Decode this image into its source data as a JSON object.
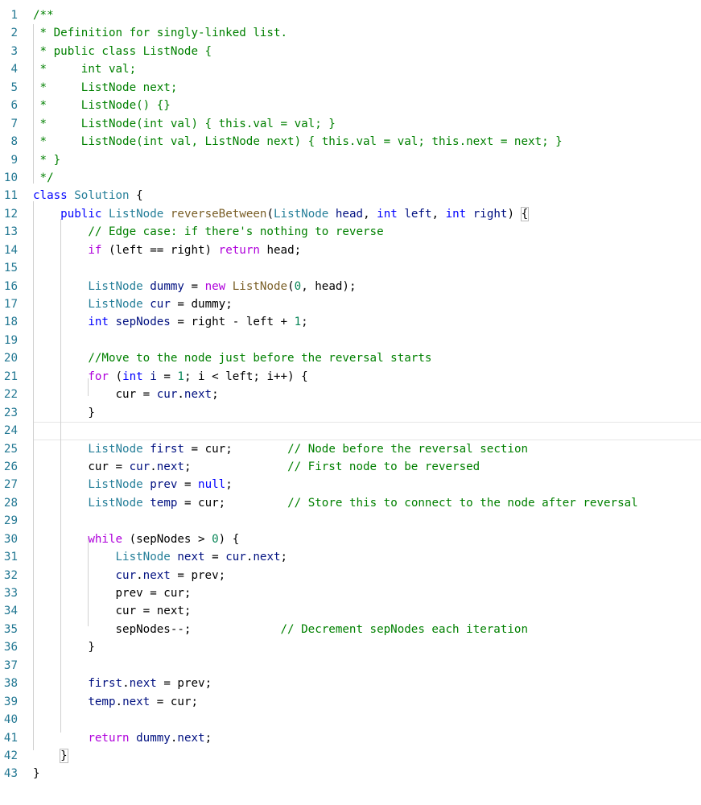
{
  "editor": {
    "language": "java",
    "colors": {
      "background": "#ffffff",
      "line_number": "#237893",
      "keyword": "#0000ff",
      "control": "#af00db",
      "type": "#267f99",
      "function": "#795e26",
      "variable": "#001080",
      "number": "#098658",
      "comment": "#008000",
      "plain": "#000000"
    },
    "current_line": 24,
    "lines": [
      {
        "number": "1",
        "tokens": [
          {
            "text": "/**",
            "type": "comment"
          }
        ]
      },
      {
        "number": "2",
        "tokens": [
          {
            "text": " * Definition for singly-linked list.",
            "type": "comment"
          }
        ]
      },
      {
        "number": "3",
        "tokens": [
          {
            "text": " * public class ListNode {",
            "type": "comment"
          }
        ]
      },
      {
        "number": "4",
        "tokens": [
          {
            "text": " *     int val;",
            "type": "comment"
          }
        ]
      },
      {
        "number": "5",
        "tokens": [
          {
            "text": " *     ListNode next;",
            "type": "comment"
          }
        ]
      },
      {
        "number": "6",
        "tokens": [
          {
            "text": " *     ListNode() {}",
            "type": "comment"
          }
        ]
      },
      {
        "number": "7",
        "tokens": [
          {
            "text": " *     ListNode(int val) { this.val = val; }",
            "type": "comment"
          }
        ]
      },
      {
        "number": "8",
        "tokens": [
          {
            "text": " *     ListNode(int val, ListNode next) { this.val = val; this.next = next; }",
            "type": "comment"
          }
        ]
      },
      {
        "number": "9",
        "tokens": [
          {
            "text": " * }",
            "type": "comment"
          }
        ]
      },
      {
        "number": "10",
        "tokens": [
          {
            "text": " */",
            "type": "comment"
          }
        ]
      },
      {
        "number": "11",
        "tokens": [
          {
            "text": "class",
            "type": "keyword"
          },
          {
            "text": " ",
            "type": "plain"
          },
          {
            "text": "Solution",
            "type": "type"
          },
          {
            "text": " {",
            "type": "plain"
          }
        ]
      },
      {
        "number": "12",
        "tokens": [
          {
            "text": "    ",
            "type": "plain"
          },
          {
            "text": "public",
            "type": "keyword"
          },
          {
            "text": " ",
            "type": "plain"
          },
          {
            "text": "ListNode",
            "type": "type"
          },
          {
            "text": " ",
            "type": "plain"
          },
          {
            "text": "reverseBetween",
            "type": "function"
          },
          {
            "text": "(",
            "type": "plain"
          },
          {
            "text": "ListNode",
            "type": "type"
          },
          {
            "text": " ",
            "type": "plain"
          },
          {
            "text": "head",
            "type": "param"
          },
          {
            "text": ", ",
            "type": "plain"
          },
          {
            "text": "int",
            "type": "keyword"
          },
          {
            "text": " ",
            "type": "plain"
          },
          {
            "text": "left",
            "type": "param"
          },
          {
            "text": ", ",
            "type": "plain"
          },
          {
            "text": "int",
            "type": "keyword"
          },
          {
            "text": " ",
            "type": "plain"
          },
          {
            "text": "right",
            "type": "param"
          },
          {
            "text": ") ",
            "type": "plain"
          },
          {
            "text": "{",
            "type": "plain",
            "box": true
          }
        ]
      },
      {
        "number": "13",
        "tokens": [
          {
            "text": "        ",
            "type": "plain"
          },
          {
            "text": "// Edge case: if there's nothing to reverse",
            "type": "comment"
          }
        ]
      },
      {
        "number": "14",
        "tokens": [
          {
            "text": "        ",
            "type": "plain"
          },
          {
            "text": "if",
            "type": "control"
          },
          {
            "text": " (left == right) ",
            "type": "plain"
          },
          {
            "text": "return",
            "type": "control"
          },
          {
            "text": " head;",
            "type": "plain"
          }
        ]
      },
      {
        "number": "15",
        "tokens": []
      },
      {
        "number": "16",
        "tokens": [
          {
            "text": "        ",
            "type": "plain"
          },
          {
            "text": "ListNode",
            "type": "type"
          },
          {
            "text": " ",
            "type": "plain"
          },
          {
            "text": "dummy",
            "type": "variable"
          },
          {
            "text": " = ",
            "type": "plain"
          },
          {
            "text": "new",
            "type": "control"
          },
          {
            "text": " ",
            "type": "plain"
          },
          {
            "text": "ListNode",
            "type": "function"
          },
          {
            "text": "(",
            "type": "plain"
          },
          {
            "text": "0",
            "type": "number"
          },
          {
            "text": ", head);",
            "type": "plain"
          }
        ]
      },
      {
        "number": "17",
        "tokens": [
          {
            "text": "        ",
            "type": "plain"
          },
          {
            "text": "ListNode",
            "type": "type"
          },
          {
            "text": " ",
            "type": "plain"
          },
          {
            "text": "cur",
            "type": "variable"
          },
          {
            "text": " = dummy;",
            "type": "plain"
          }
        ]
      },
      {
        "number": "18",
        "tokens": [
          {
            "text": "        ",
            "type": "plain"
          },
          {
            "text": "int",
            "type": "keyword"
          },
          {
            "text": " ",
            "type": "plain"
          },
          {
            "text": "sepNodes",
            "type": "variable"
          },
          {
            "text": " = right - left + ",
            "type": "plain"
          },
          {
            "text": "1",
            "type": "number"
          },
          {
            "text": ";",
            "type": "plain"
          }
        ]
      },
      {
        "number": "19",
        "tokens": []
      },
      {
        "number": "20",
        "tokens": [
          {
            "text": "        ",
            "type": "plain"
          },
          {
            "text": "//Move to the node just before the reversal starts",
            "type": "comment"
          }
        ]
      },
      {
        "number": "21",
        "tokens": [
          {
            "text": "        ",
            "type": "plain"
          },
          {
            "text": "for",
            "type": "control"
          },
          {
            "text": " (",
            "type": "plain"
          },
          {
            "text": "int",
            "type": "keyword"
          },
          {
            "text": " ",
            "type": "plain"
          },
          {
            "text": "i",
            "type": "variable"
          },
          {
            "text": " = ",
            "type": "plain"
          },
          {
            "text": "1",
            "type": "number"
          },
          {
            "text": "; i < left; i++) {",
            "type": "plain"
          }
        ]
      },
      {
        "number": "22",
        "tokens": [
          {
            "text": "            ",
            "type": "plain"
          },
          {
            "text": "cur = ",
            "type": "plain"
          },
          {
            "text": "cur",
            "type": "variable"
          },
          {
            "text": ".",
            "type": "plain"
          },
          {
            "text": "next",
            "type": "member"
          },
          {
            "text": ";",
            "type": "plain"
          }
        ]
      },
      {
        "number": "23",
        "tokens": [
          {
            "text": "        ",
            "type": "plain"
          },
          {
            "text": "}",
            "type": "plain"
          }
        ]
      },
      {
        "number": "24",
        "tokens": []
      },
      {
        "number": "25",
        "tokens": [
          {
            "text": "        ",
            "type": "plain"
          },
          {
            "text": "ListNode",
            "type": "type"
          },
          {
            "text": " ",
            "type": "plain"
          },
          {
            "text": "first",
            "type": "variable"
          },
          {
            "text": " = cur;        ",
            "type": "plain"
          },
          {
            "text": "// Node before the reversal section",
            "type": "comment"
          }
        ]
      },
      {
        "number": "26",
        "tokens": [
          {
            "text": "        ",
            "type": "plain"
          },
          {
            "text": "cur = ",
            "type": "plain"
          },
          {
            "text": "cur",
            "type": "variable"
          },
          {
            "text": ".",
            "type": "plain"
          },
          {
            "text": "next",
            "type": "member"
          },
          {
            "text": ";              ",
            "type": "plain"
          },
          {
            "text": "// First node to be reversed",
            "type": "comment"
          }
        ]
      },
      {
        "number": "27",
        "tokens": [
          {
            "text": "        ",
            "type": "plain"
          },
          {
            "text": "ListNode",
            "type": "type"
          },
          {
            "text": " ",
            "type": "plain"
          },
          {
            "text": "prev",
            "type": "variable"
          },
          {
            "text": " = ",
            "type": "plain"
          },
          {
            "text": "null",
            "type": "keyword"
          },
          {
            "text": ";",
            "type": "plain"
          }
        ]
      },
      {
        "number": "28",
        "tokens": [
          {
            "text": "        ",
            "type": "plain"
          },
          {
            "text": "ListNode",
            "type": "type"
          },
          {
            "text": " ",
            "type": "plain"
          },
          {
            "text": "temp",
            "type": "variable"
          },
          {
            "text": " = cur;         ",
            "type": "plain"
          },
          {
            "text": "// Store this to connect to the node after reversal",
            "type": "comment"
          }
        ]
      },
      {
        "number": "29",
        "tokens": []
      },
      {
        "number": "30",
        "tokens": [
          {
            "text": "        ",
            "type": "plain"
          },
          {
            "text": "while",
            "type": "control"
          },
          {
            "text": " (sepNodes > ",
            "type": "plain"
          },
          {
            "text": "0",
            "type": "number"
          },
          {
            "text": ") {",
            "type": "plain"
          }
        ]
      },
      {
        "number": "31",
        "tokens": [
          {
            "text": "            ",
            "type": "plain"
          },
          {
            "text": "ListNode",
            "type": "type"
          },
          {
            "text": " ",
            "type": "plain"
          },
          {
            "text": "next",
            "type": "variable"
          },
          {
            "text": " = ",
            "type": "plain"
          },
          {
            "text": "cur",
            "type": "variable"
          },
          {
            "text": ".",
            "type": "plain"
          },
          {
            "text": "next",
            "type": "member"
          },
          {
            "text": ";",
            "type": "plain"
          }
        ]
      },
      {
        "number": "32",
        "tokens": [
          {
            "text": "            ",
            "type": "plain"
          },
          {
            "text": "cur",
            "type": "variable"
          },
          {
            "text": ".",
            "type": "plain"
          },
          {
            "text": "next",
            "type": "member"
          },
          {
            "text": " = prev;",
            "type": "plain"
          }
        ]
      },
      {
        "number": "33",
        "tokens": [
          {
            "text": "            ",
            "type": "plain"
          },
          {
            "text": "prev = cur;",
            "type": "plain"
          }
        ]
      },
      {
        "number": "34",
        "tokens": [
          {
            "text": "            ",
            "type": "plain"
          },
          {
            "text": "cur = next;",
            "type": "plain"
          }
        ]
      },
      {
        "number": "35",
        "tokens": [
          {
            "text": "            ",
            "type": "plain"
          },
          {
            "text": "sepNodes--;             ",
            "type": "plain"
          },
          {
            "text": "// Decrement sepNodes each iteration",
            "type": "comment"
          }
        ]
      },
      {
        "number": "36",
        "tokens": [
          {
            "text": "        ",
            "type": "plain"
          },
          {
            "text": "}",
            "type": "plain"
          }
        ]
      },
      {
        "number": "37",
        "tokens": []
      },
      {
        "number": "38",
        "tokens": [
          {
            "text": "        ",
            "type": "plain"
          },
          {
            "text": "first",
            "type": "variable"
          },
          {
            "text": ".",
            "type": "plain"
          },
          {
            "text": "next",
            "type": "member"
          },
          {
            "text": " = prev;",
            "type": "plain"
          }
        ]
      },
      {
        "number": "39",
        "tokens": [
          {
            "text": "        ",
            "type": "plain"
          },
          {
            "text": "temp",
            "type": "variable"
          },
          {
            "text": ".",
            "type": "plain"
          },
          {
            "text": "next",
            "type": "member"
          },
          {
            "text": " = cur;",
            "type": "plain"
          }
        ]
      },
      {
        "number": "40",
        "tokens": []
      },
      {
        "number": "41",
        "tokens": [
          {
            "text": "        ",
            "type": "plain"
          },
          {
            "text": "return",
            "type": "control"
          },
          {
            "text": " ",
            "type": "plain"
          },
          {
            "text": "dummy",
            "type": "variable"
          },
          {
            "text": ".",
            "type": "plain"
          },
          {
            "text": "next",
            "type": "member"
          },
          {
            "text": ";",
            "type": "plain"
          }
        ]
      },
      {
        "number": "42",
        "tokens": [
          {
            "text": "    ",
            "type": "plain"
          },
          {
            "text": "}",
            "type": "plain",
            "box": true
          }
        ]
      },
      {
        "number": "43",
        "tokens": [
          {
            "text": "}",
            "type": "plain"
          }
        ]
      }
    ]
  }
}
